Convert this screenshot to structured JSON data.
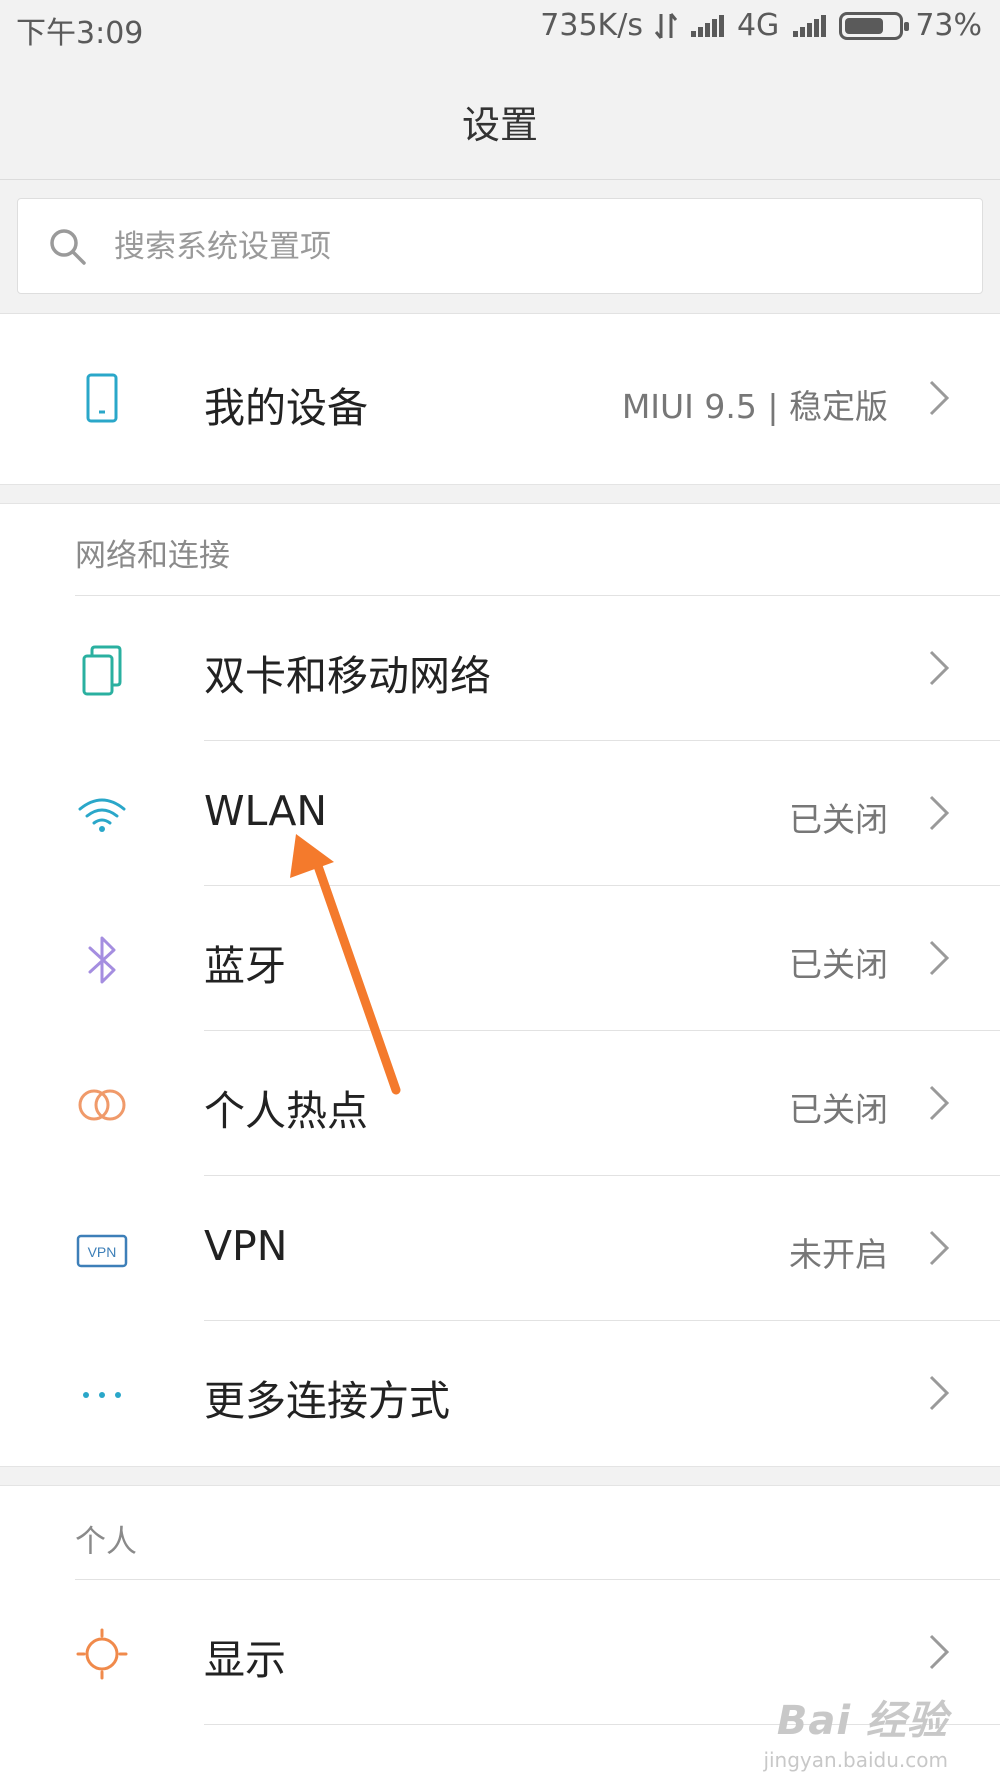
{
  "status_bar": {
    "time": "下午3:09",
    "speed": "735K/s",
    "network": "4G",
    "battery_text": "73%",
    "battery_level": 0.73
  },
  "header": {
    "title": "设置"
  },
  "search": {
    "placeholder": "搜索系统设置项"
  },
  "device": {
    "label": "我的设备",
    "value": "MIUI 9.5 | 稳定版"
  },
  "network_section": {
    "title": "网络和连接",
    "items": [
      {
        "label": "双卡和移动网络",
        "value": "",
        "icon": "dual-sim-icon"
      },
      {
        "label": "WLAN",
        "value": "已关闭",
        "icon": "wifi-icon"
      },
      {
        "label": "蓝牙",
        "value": "已关闭",
        "icon": "bluetooth-icon"
      },
      {
        "label": "个人热点",
        "value": "已关闭",
        "icon": "hotspot-icon"
      },
      {
        "label": "VPN",
        "value": "未开启",
        "icon": "vpn-icon"
      },
      {
        "label": "更多连接方式",
        "value": "",
        "icon": "more-icon"
      }
    ]
  },
  "personal_section": {
    "title": "个人",
    "items": [
      {
        "label": "显示",
        "value": "",
        "icon": "brightness-icon"
      }
    ]
  },
  "icons": {
    "vpn_text": "VPN"
  },
  "colors": {
    "annotation_arrow": "#f47a2c",
    "wifi": "#2aa7c9",
    "bluetooth": "#a58ee0",
    "hotspot": "#f09a6a",
    "device": "#2aa7c9",
    "vpn": "#3d7fb8",
    "brightness": "#f08a4b"
  },
  "watermark": {
    "logo": "Bai 经验",
    "url": "jingyan.baidu.com"
  }
}
